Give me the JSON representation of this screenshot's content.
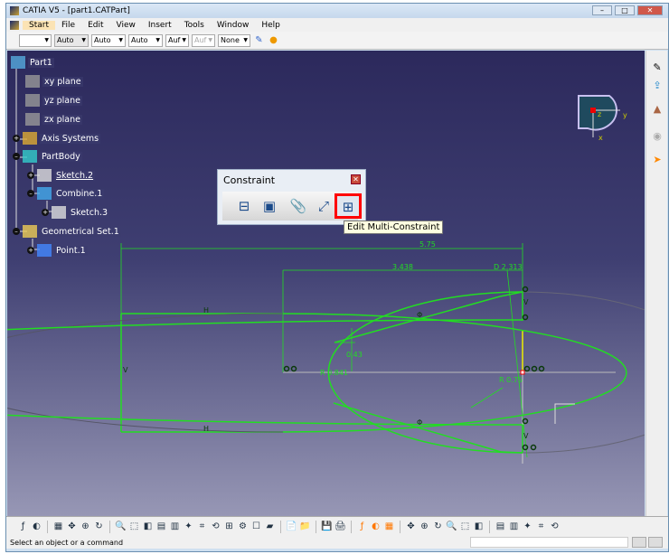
{
  "window": {
    "title": "CATIA V5 - [part1.CATPart]"
  },
  "menu": [
    "Start",
    "File",
    "Edit",
    "View",
    "Insert",
    "Tools",
    "Window",
    "Help"
  ],
  "toolbar": {
    "combos": [
      "",
      "Auto",
      "Auto",
      "Auto",
      "Auf",
      "Auf",
      "None"
    ]
  },
  "tree": {
    "items": [
      {
        "label": "Part1",
        "icon": "part-icon"
      },
      {
        "label": "xy plane",
        "icon": "plane-icon"
      },
      {
        "label": "yz plane",
        "icon": "plane-icon"
      },
      {
        "label": "zx plane",
        "icon": "plane-icon"
      },
      {
        "label": "Axis Systems",
        "icon": "axis-system-icon"
      },
      {
        "label": "PartBody",
        "icon": "body-icon"
      },
      {
        "label": "Sketch.2",
        "icon": "sketch-icon"
      },
      {
        "label": "Combine.1",
        "icon": "combine-icon"
      },
      {
        "label": "Sketch.3",
        "icon": "sketch-icon"
      },
      {
        "label": "Geometrical Set.1",
        "icon": "geometrical-set-icon"
      },
      {
        "label": "Point.1",
        "icon": "point-icon"
      }
    ]
  },
  "constraint_panel": {
    "title": "Constraint",
    "buttons": [
      "constraints-defined-in-dialog",
      "constraint",
      "contact-constraint",
      "fix-together",
      "edit-multi-constraint"
    ],
    "tooltip": "Edit Multi-Constraint"
  },
  "sketch": {
    "dims": {
      "overall": "5.75",
      "center": "3.438",
      "diameter": "D 2.313",
      "offset": "0.43",
      "r_left": "R 0.841",
      "r_right": "R 0.75"
    },
    "constraints": {
      "h": "H",
      "v": "V",
      "tangent": "Φ"
    },
    "accent": "#22dd22"
  },
  "compass": {
    "z": "z",
    "y": "y",
    "x": "x"
  },
  "status": {
    "text": "Select an object or a command"
  }
}
